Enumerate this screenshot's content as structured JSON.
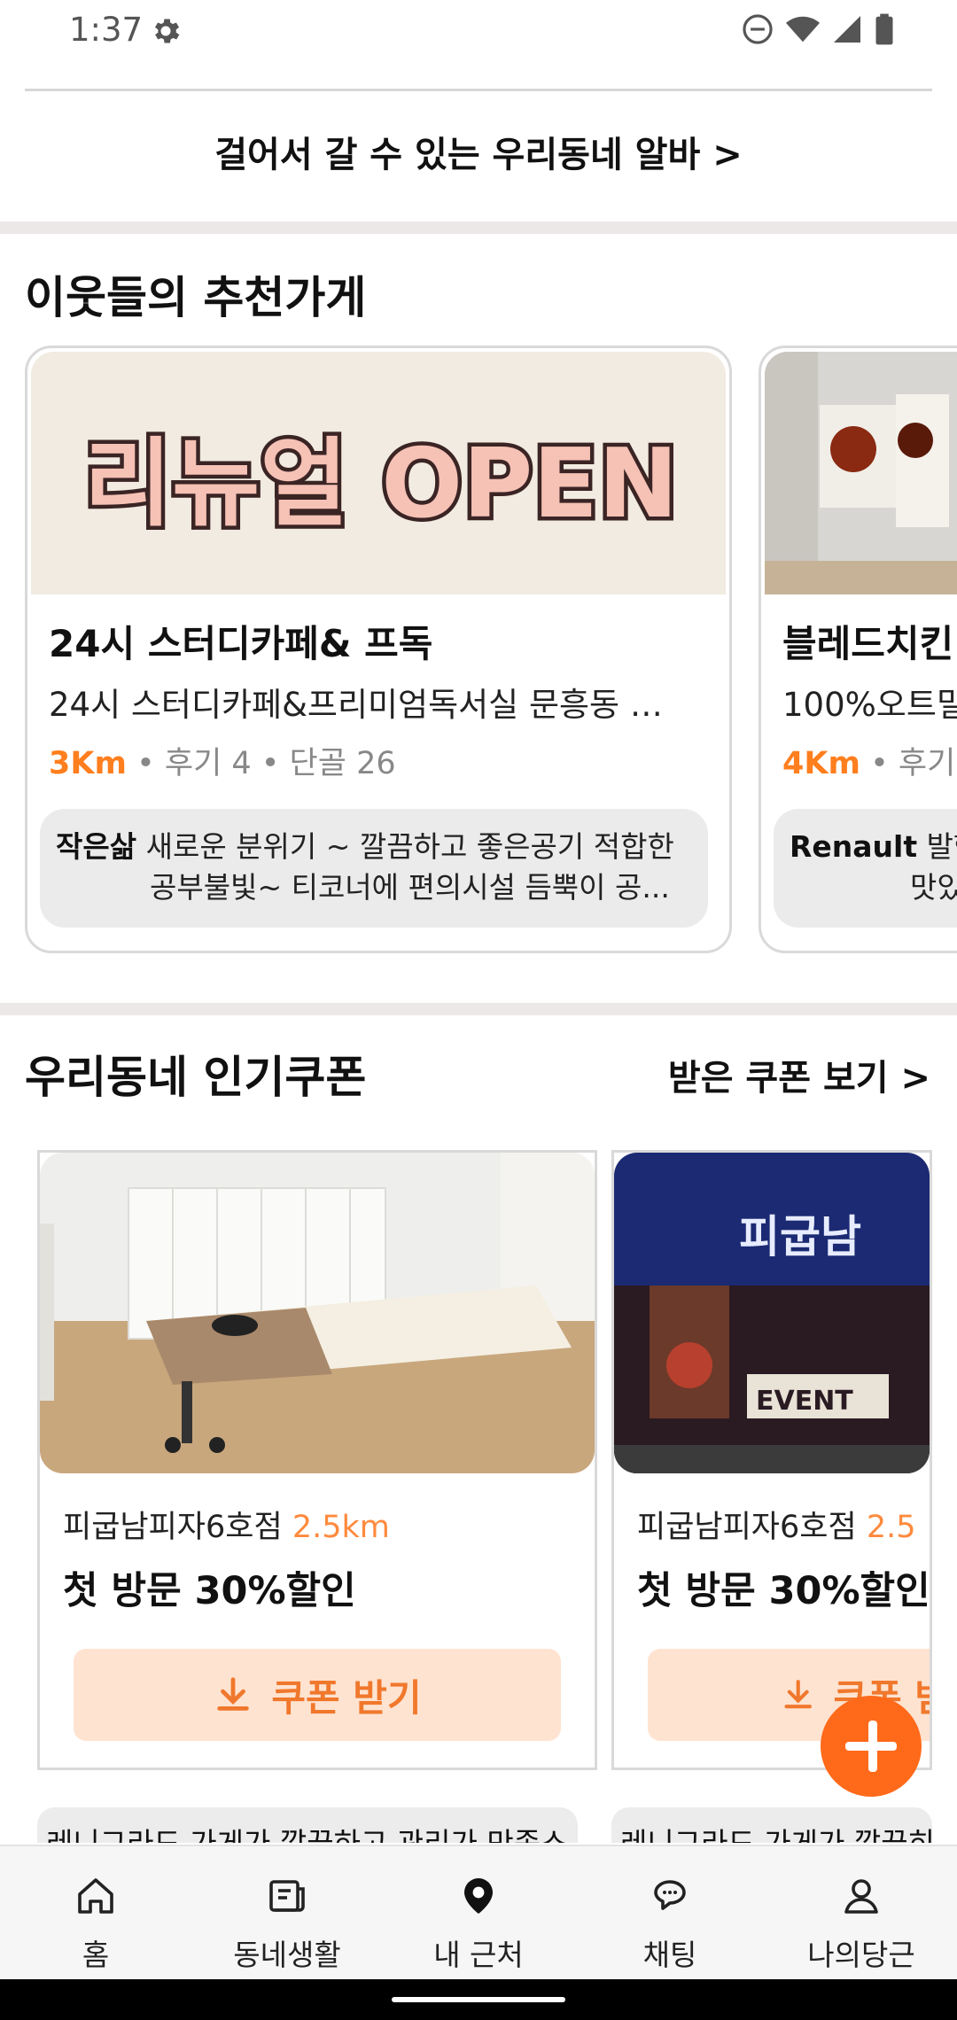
{
  "status_bar": {
    "time": "1:37"
  },
  "walk_banner": "걸어서 갈 수 있는 우리동네 알바 >",
  "recommend": {
    "title": "이웃들의 추천가게",
    "cards": [
      {
        "image_text": "리뉴얼 OPEN",
        "name": "24시 스터디카페& 프독",
        "desc": "24시 스터디카페&프리미엄독서실 문흥동 …",
        "km": "3Km",
        "meta": "• 후기 4 • 단골 26",
        "review_author": "작은삶",
        "review_line1": "새로운 분위기 ~ 깔끔하고 좋은공기 적합한",
        "review_line2": "공부불빛~ 티코너에 편의시설 듬뿍이 공..."
      },
      {
        "name": "블레드치킨",
        "desc": "100%오트밀",
        "km": "4Km",
        "meta": "• 후기",
        "review_author": "Renault",
        "review_line1": "발행",
        "review_line2": "맛있"
      }
    ]
  },
  "coupons": {
    "title": "우리동네 인기쿠폰",
    "link": "받은 쿠폰 보기 >",
    "cards": [
      {
        "store": "피굽남피자6호점",
        "distance": "2.5km",
        "title": "첫 방문 30%할인",
        "button": "쿠폰 받기"
      },
      {
        "store": "피굽남피자6호점",
        "distance": "2.5",
        "title": "첫 방문 30%할인",
        "button": "쿠폰 받",
        "image_sign": "피굽남",
        "image_event": "EVENT"
      }
    ],
    "peek": [
      "레니그라드 가게가 깔끔하고 관리가 만족스",
      "레니그라드 가게가 깔끔히"
    ]
  },
  "nav": {
    "items": [
      {
        "label": "홈",
        "icon": "home-icon"
      },
      {
        "label": "동네생활",
        "icon": "neighborhood-icon"
      },
      {
        "label": "내 근처",
        "icon": "location-pin-icon"
      },
      {
        "label": "채팅",
        "icon": "chat-icon"
      },
      {
        "label": "나의당근",
        "icon": "profile-icon"
      }
    ]
  },
  "colors": {
    "accent": "#ff6a1a",
    "distance": "#ff7e1e",
    "coupon_bg": "#ffe3d1"
  }
}
